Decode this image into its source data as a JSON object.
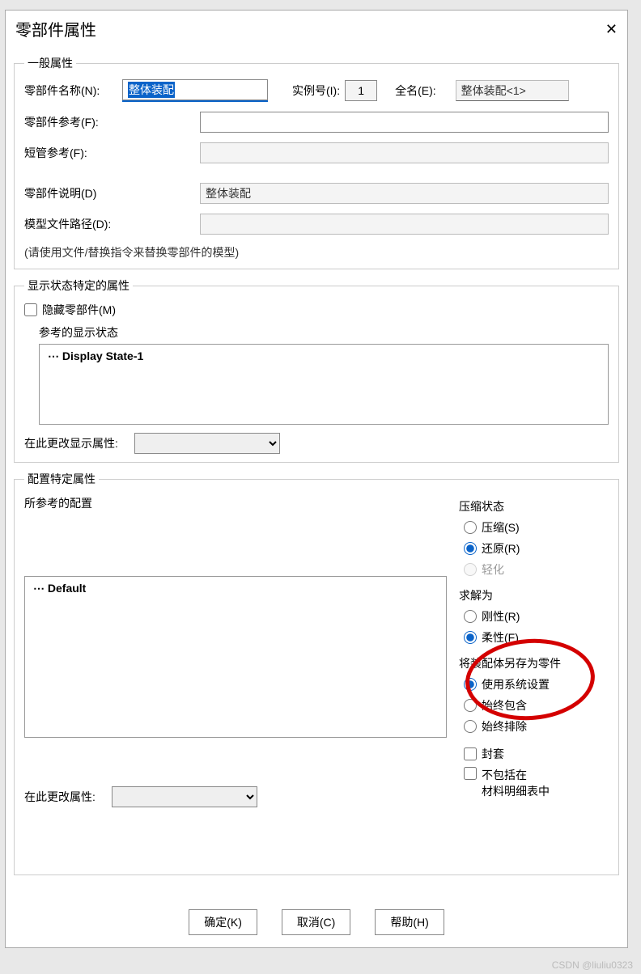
{
  "dialog": {
    "title": "零部件属性"
  },
  "general": {
    "legend": "一般属性",
    "name_label": "零部件名称(N):",
    "name_value": "整体装配",
    "instance_label": "实例号(I):",
    "instance_value": "1",
    "fullname_label": "全名(E):",
    "fullname_value": "整体装配<1>",
    "ref_label": "零部件参考(F):",
    "ref_value": "",
    "short_ref_label": "短管参考(F):",
    "short_ref_value": "",
    "desc_label": "零部件说明(D)",
    "desc_value": "整体装配",
    "path_label": "模型文件路径(D):",
    "path_value": "",
    "hint": "(请使用文件/替换指令来替换零部件的模型)"
  },
  "display": {
    "legend": "显示状态特定的属性",
    "hide_label": "隐藏零部件(M)",
    "ref_states_label": "参考的显示状态",
    "state_item": "Display State-1",
    "change_label": "在此更改显示属性:"
  },
  "config": {
    "legend": "配置特定属性",
    "ref_config_label": "所参考的配置",
    "default_item": "Default",
    "change_label": "在此更改属性:",
    "compress": {
      "legend": "压缩状态",
      "opt_compress": "压缩(S)",
      "opt_restore": "还原(R)",
      "opt_light": "轻化"
    },
    "solve": {
      "legend": "求解为",
      "opt_rigid": "刚性(R)",
      "opt_flex": "柔性(F)"
    },
    "saveas": {
      "legend": "将装配体另存为零件",
      "opt_system": "使用系统设置",
      "opt_include": "始终包含",
      "opt_exclude": "始终排除"
    },
    "cover_label": "封套",
    "exclude_bom1": "不包括在",
    "exclude_bom2": "材料明细表中"
  },
  "buttons": {
    "ok": "确定(K)",
    "cancel": "取消(C)",
    "help": "帮助(H)"
  },
  "watermark": "CSDN @liuliu0323"
}
